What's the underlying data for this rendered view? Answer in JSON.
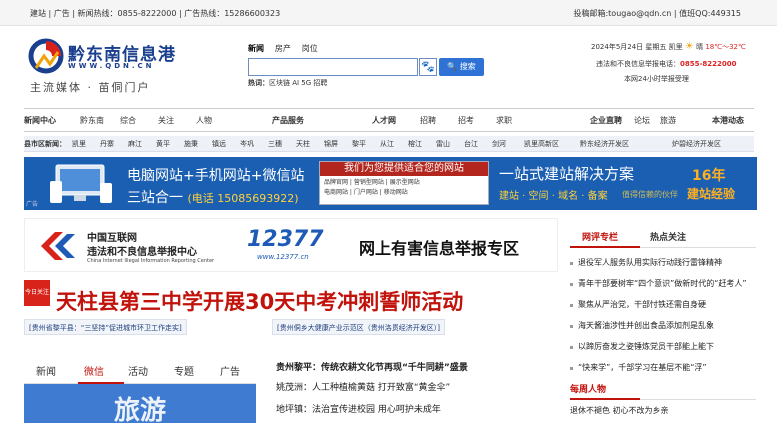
{
  "topbar": {
    "left": "建站 | 广告 | 新闻热线：0855-8222000 | 广告热线：15286600323",
    "right": "投稿邮箱:tougao@qdn.cn | 值班QQ:449315"
  },
  "logo": {
    "name": "黔东南信息港",
    "url": "WWW.QDN.CN",
    "slogan": "主流媒体 · 苗侗门户"
  },
  "search": {
    "tabs": [
      "新闻",
      "房产",
      "岗位"
    ],
    "placeholder": "",
    "button": "搜索",
    "hot_label": "热词：",
    "hot_terms": "区块链 AI 5G 招聘"
  },
  "header_right": {
    "date": "2024年5月24日 星期五",
    "city": "凯里",
    "weather": "晴",
    "temp": "18℃～32℃",
    "report_label": "违法和不良信息举报电话：",
    "report_tel": "0855-8222000",
    "report_note": "本网24小时举报受理"
  },
  "nav": [
    "新闻中心",
    "黔东南",
    "综合",
    "关注",
    "人物",
    "产品服务",
    "人才网",
    "招聘",
    "招考",
    "求职",
    "企业直聘",
    "论坛",
    "旅游",
    "本港动态"
  ],
  "county_nav": [
    "县市区新闻：",
    "凯里",
    "丹寨",
    "麻江",
    "黄平",
    "施秉",
    "镇远",
    "岑巩",
    "三穗",
    "天柱",
    "锦屏",
    "黎平",
    "从江",
    "榕江",
    "雷山",
    "台江",
    "剑河",
    "凯里高新区",
    "黔东经济开发区",
    "炉碧经济开发区"
  ],
  "banner": {
    "line1": "电脑网站+手机网站+微信站",
    "line2": "三站合一",
    "tel": "(电话 15085693922)",
    "mid_title": "我们为您提供适合您的网站",
    "mid_items": [
      "品牌官网",
      "营销型网站",
      "展示型网站",
      "电商网站",
      "门户网站",
      "移动网站"
    ],
    "right1": "一站式建站解决方案",
    "right2": "建站 · 空间 · 域名 · 备案",
    "right3": "值得信赖的伙伴",
    "years": "16年",
    "exp": "建站经验",
    "ad": "广告"
  },
  "report": {
    "org1": "中国互联网",
    "org2": "违法和不良信息举报中心",
    "org3": "China Internet Illegal Information Reporting Center",
    "number": "12377",
    "site": "www.12377.cn",
    "zone": "网上有害信息举报专区"
  },
  "headline": {
    "ribbon": "今日关注",
    "title": "天柱县第三中学开展30天中考冲刺誓师活动",
    "subs": [
      "[贵州省黎平县：“三坚持”促进城市环卫工作走实]",
      "[贵州侗乡大健康产业示范区（贵州洛贯经济开发区）]"
    ]
  },
  "tabs2": [
    "新闻",
    "微信",
    "活动",
    "专题",
    "广告"
  ],
  "thumb_text": "旅游",
  "news": [
    {
      "place": "贵州黎平：",
      "title": "传统农耕文化节再现“千牛同耕”盛景"
    },
    {
      "place": "姚茂洲：",
      "title": "人工种植榆黄菇 打开致富“黄金伞”"
    },
    {
      "place": "地坪镇：",
      "title": "法治宣传进校园 用心呵护未成年"
    }
  ],
  "right_tabs": [
    "网评专栏",
    "热点关注"
  ],
  "right_list": [
    "退役军人服务队用实际行动践行雷锋精神",
    "青年干部要树牢“四个意识”做新时代的“赶考人”",
    "聚焦从严治党，干部忖铁还需自身硬",
    "海天酱油涉性并创出食品添加剂是乱象",
    "以蹄厉奋发之姿锤炼党员干部能上能下",
    "“快来学”，千部学习在基层不能“浮”"
  ],
  "weekly": "每周人物",
  "weekly_item": "退休不褪色 初心不改为乡亲",
  "colors": {
    "brand": "#1a3f8f",
    "accent": "#c1120b",
    "button": "#2f72d6",
    "banner": "#1b5fb3"
  }
}
